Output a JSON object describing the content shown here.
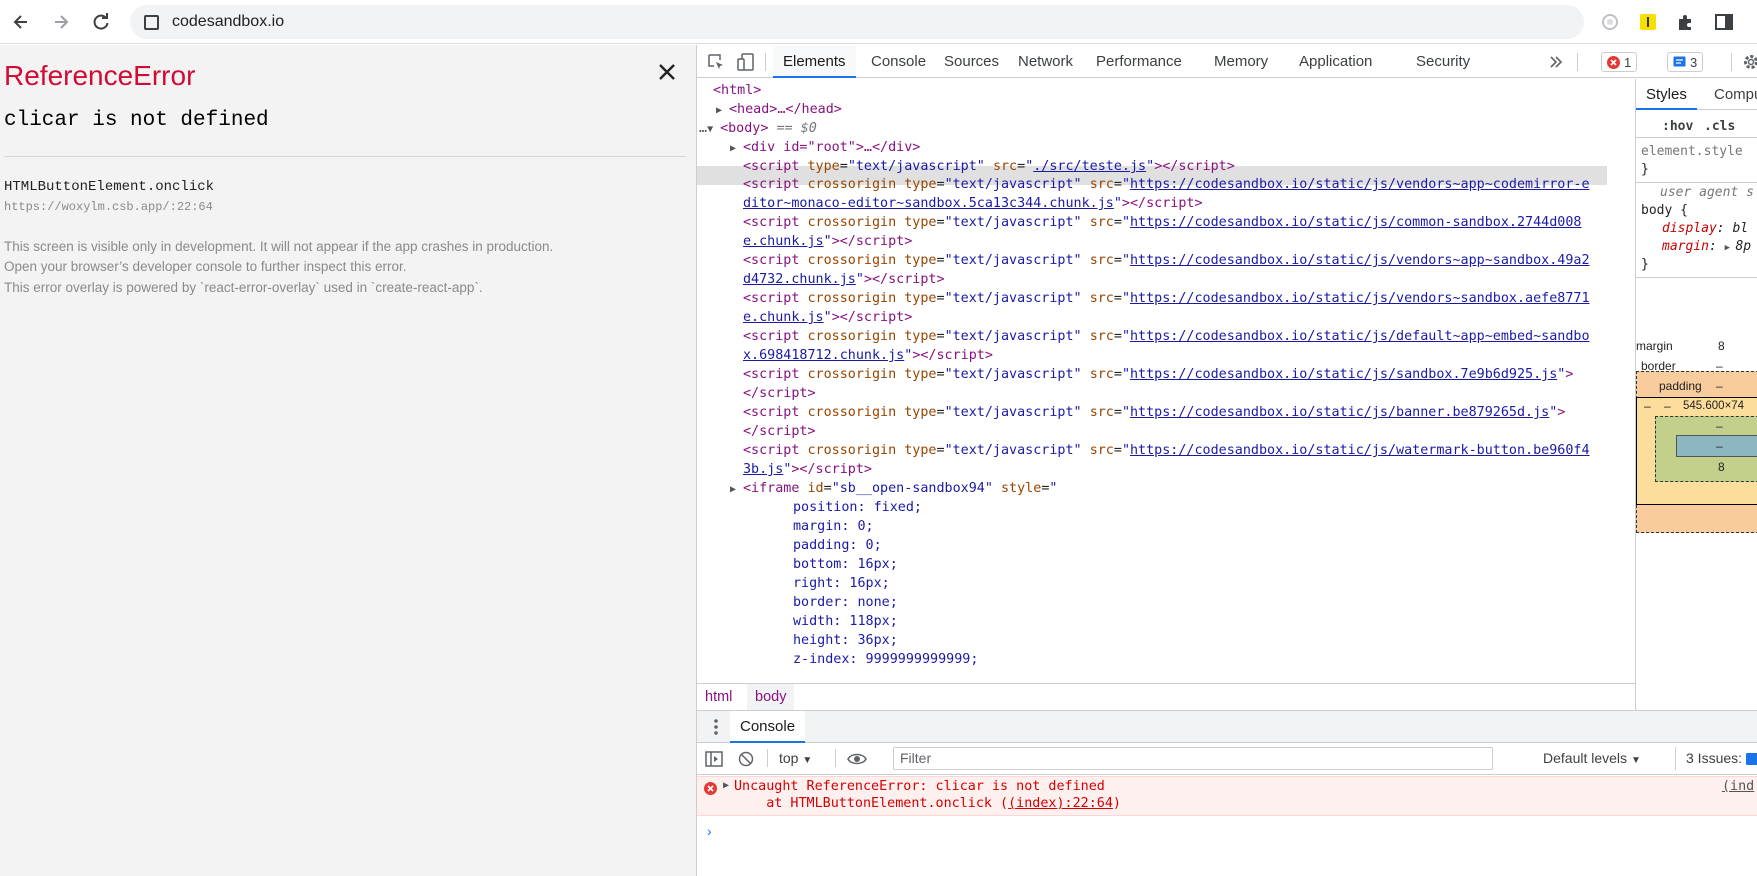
{
  "browser": {
    "url": "codesandbox.io"
  },
  "overlay": {
    "title": "ReferenceError",
    "message": "clicar is not defined",
    "frame_function": "HTMLButtonElement.onclick",
    "frame_location": "https://woxylm.csb.app/:22:64",
    "notes": [
      "This screen is visible only in development. It will not appear if the app crashes in production.",
      "Open your browser’s developer console to further inspect this error.",
      "This error overlay is powered by `react-error-overlay` used in `create-react-app`."
    ]
  },
  "devtools": {
    "tabs": [
      "Elements",
      "Console",
      "Sources",
      "Network",
      "Performance",
      "Memory",
      "Application",
      "Security"
    ],
    "active_tab": "Elements",
    "error_count": "1",
    "message_count": "3",
    "breadcrumbs": [
      "html",
      "body"
    ],
    "styles": {
      "tabs": [
        "Styles",
        "Computed"
      ],
      "hov": ":hov",
      "cls": ".cls",
      "element_style": "element.style",
      "ua_label": "user agent s",
      "body_selector": "body {",
      "prop1": "display",
      "val1": "bl",
      "prop2": "margin",
      "val2": "8p",
      "close_brace": "}",
      "box_margin": "margin",
      "box_border": "border",
      "box_padding": "padding",
      "box_content": "545.600×74",
      "margin_top": "8",
      "margin_bottom": "8",
      "dash": "–"
    },
    "console": {
      "drawer_tab": "Console",
      "context": "top",
      "filter_placeholder": "Filter",
      "levels": "Default levels",
      "issues": "3 Issues:",
      "error_line1": "Uncaught ReferenceError: clicar is not defined",
      "error_line2_prefix": "    at HTMLButtonElement.onclick (",
      "error_link": "(index):22:64",
      "error_line2_suffix": ")",
      "error_source": "(ind",
      "prompt": "›"
    }
  },
  "dom_tree": {
    "html_open": "<html>",
    "head": "<head>…</head>",
    "body_open": "<body>",
    "body_marker": " == $0",
    "div_root": "<div id=\"root\">…</div>",
    "script_local_src": "./src/teste.js",
    "scripts": [
      [
        "https://codesandbox.io/static/js/vendors~app~codemirror-e",
        "ditor~monaco-editor~sandbox.5ca13c344.chunk.js"
      ],
      [
        "https://codesandbox.io/static/js/common-sandbox.2744d008",
        "e.chunk.js"
      ],
      [
        "https://codesandbox.io/static/js/vendors~app~sandbox.49a2",
        "d4732.chunk.js"
      ],
      [
        "https://codesandbox.io/static/js/vendors~sandbox.aefe8771",
        "e.chunk.js"
      ],
      [
        "https://codesandbox.io/static/js/default~app~embed~sandbo",
        "x.698418712.chunk.js"
      ],
      [
        "https://codesandbox.io/static/js/sandbox.7e9b6d925.js",
        ""
      ],
      [
        "https://codesandbox.io/static/js/banner.be879265d.js",
        ""
      ],
      [
        "https://codesandbox.io/static/js/watermark-button.be960f4",
        "3b.js"
      ]
    ],
    "iframe_id": "sb__open-sandbox94",
    "iframe_styles": [
      "position: fixed;",
      "margin: 0;",
      "padding: 0;",
      "bottom: 16px;",
      "right: 16px;",
      "border: none;",
      "width: 118px;",
      "height: 36px;",
      "z-index: 9999999999999;"
    ]
  }
}
